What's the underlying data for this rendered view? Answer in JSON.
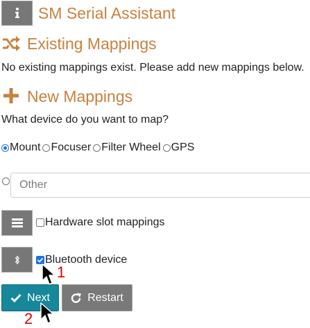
{
  "app": {
    "title": "SM Serial Assistant"
  },
  "existing": {
    "heading": "Existing Mappings",
    "message": "No existing mappings exist. Please add new mappings below."
  },
  "new_mappings": {
    "heading": "New Mappings",
    "question": "What device do you want to map?",
    "device_options": [
      {
        "label": "Mount",
        "selected": true
      },
      {
        "label": "Focuser",
        "selected": false
      },
      {
        "label": "Filter Wheel",
        "selected": false
      },
      {
        "label": "GPS",
        "selected": false
      }
    ],
    "other_placeholder": "Other"
  },
  "options": {
    "hardware_slot_label": "Hardware slot mappings",
    "hardware_slot_checked": false,
    "bluetooth_label": "Bluetooth device",
    "bluetooth_checked": true
  },
  "buttons": {
    "next_label": "Next",
    "restart_label": "Restart"
  },
  "annotations": {
    "step1": "1",
    "step2": "2"
  },
  "colors": {
    "heading": "#c8813e",
    "primary_button": "#17879b",
    "secondary_button": "#797979",
    "step_marker": "#e00000"
  },
  "icons": {
    "info": "info-icon",
    "existing": "shuffle-icon",
    "new": "plus-icon",
    "hardware": "list-icon",
    "bluetooth": "bluetooth-icon",
    "next": "check-icon",
    "restart": "redo-icon"
  }
}
